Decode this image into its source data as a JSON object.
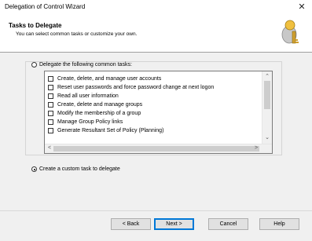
{
  "window": {
    "title": "Delegation of Control Wizard",
    "close_glyph": "✕"
  },
  "header": {
    "title": "Tasks to Delegate",
    "subtitle": "You can select common tasks or customize your own.",
    "icon": "delegation-wizard-icon"
  },
  "options": {
    "common_label": "Delegate the following common tasks:",
    "common_selected": false,
    "custom_label": "Create a custom task to delegate",
    "custom_selected": true
  },
  "tasks": {
    "items": [
      {
        "label": "Create, delete, and manage user accounts",
        "checked": false
      },
      {
        "label": "Reset user passwords and force password change at next logon",
        "checked": false
      },
      {
        "label": "Read all user information",
        "checked": false
      },
      {
        "label": "Create, delete and manage groups",
        "checked": false
      },
      {
        "label": "Modify the membership of a group",
        "checked": false
      },
      {
        "label": "Manage Group Policy links",
        "checked": false
      },
      {
        "label": "Generate Resultant Set of Policy (Planning)",
        "checked": false
      }
    ],
    "scroll_up_glyph": "⌃",
    "scroll_down_glyph": "⌄",
    "scroll_left_glyph": "<",
    "scroll_right_glyph": ">"
  },
  "buttons": {
    "back": "< Back",
    "next": "Next >",
    "cancel": "Cancel",
    "help": "Help"
  }
}
